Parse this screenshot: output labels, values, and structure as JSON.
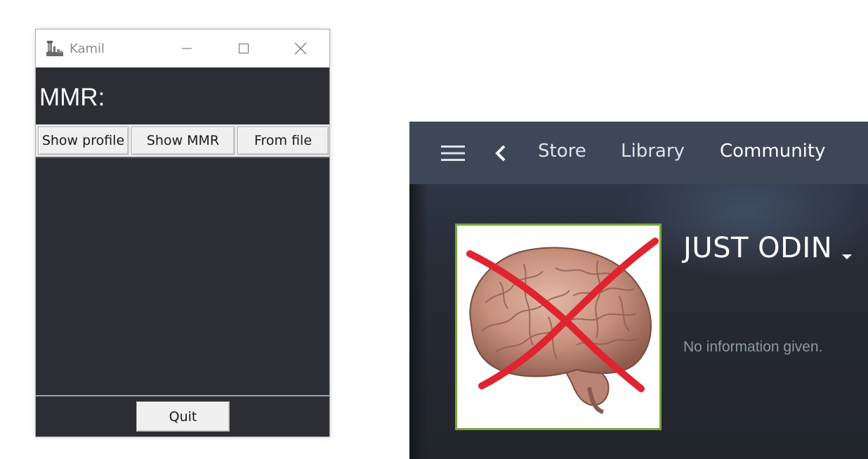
{
  "tk_window": {
    "title": "Kamil",
    "mmr_label": "MMR:",
    "buttons": {
      "show_profile": "Show profile",
      "show_mmr": "Show MMR",
      "from_file": "From file",
      "quit": "Quit"
    },
    "output_text": ""
  },
  "steam": {
    "nav": {
      "items": [
        "Store",
        "Library",
        "Community"
      ],
      "active": "Community"
    },
    "profile": {
      "persona_name": "JUST ODIN",
      "summary": "No information given."
    },
    "colors": {
      "nav_bg": "#3d4758",
      "avatar_border": "#7ba43a"
    }
  },
  "icons": {
    "app": "app-icon",
    "minimize": "minimize-icon",
    "maximize": "maximize-icon",
    "close": "close-icon",
    "menu": "hamburger-menu-icon",
    "back": "chevron-left-icon",
    "persona_dropdown": "caret-down-icon",
    "avatar": "crossed-out-brain-image"
  }
}
